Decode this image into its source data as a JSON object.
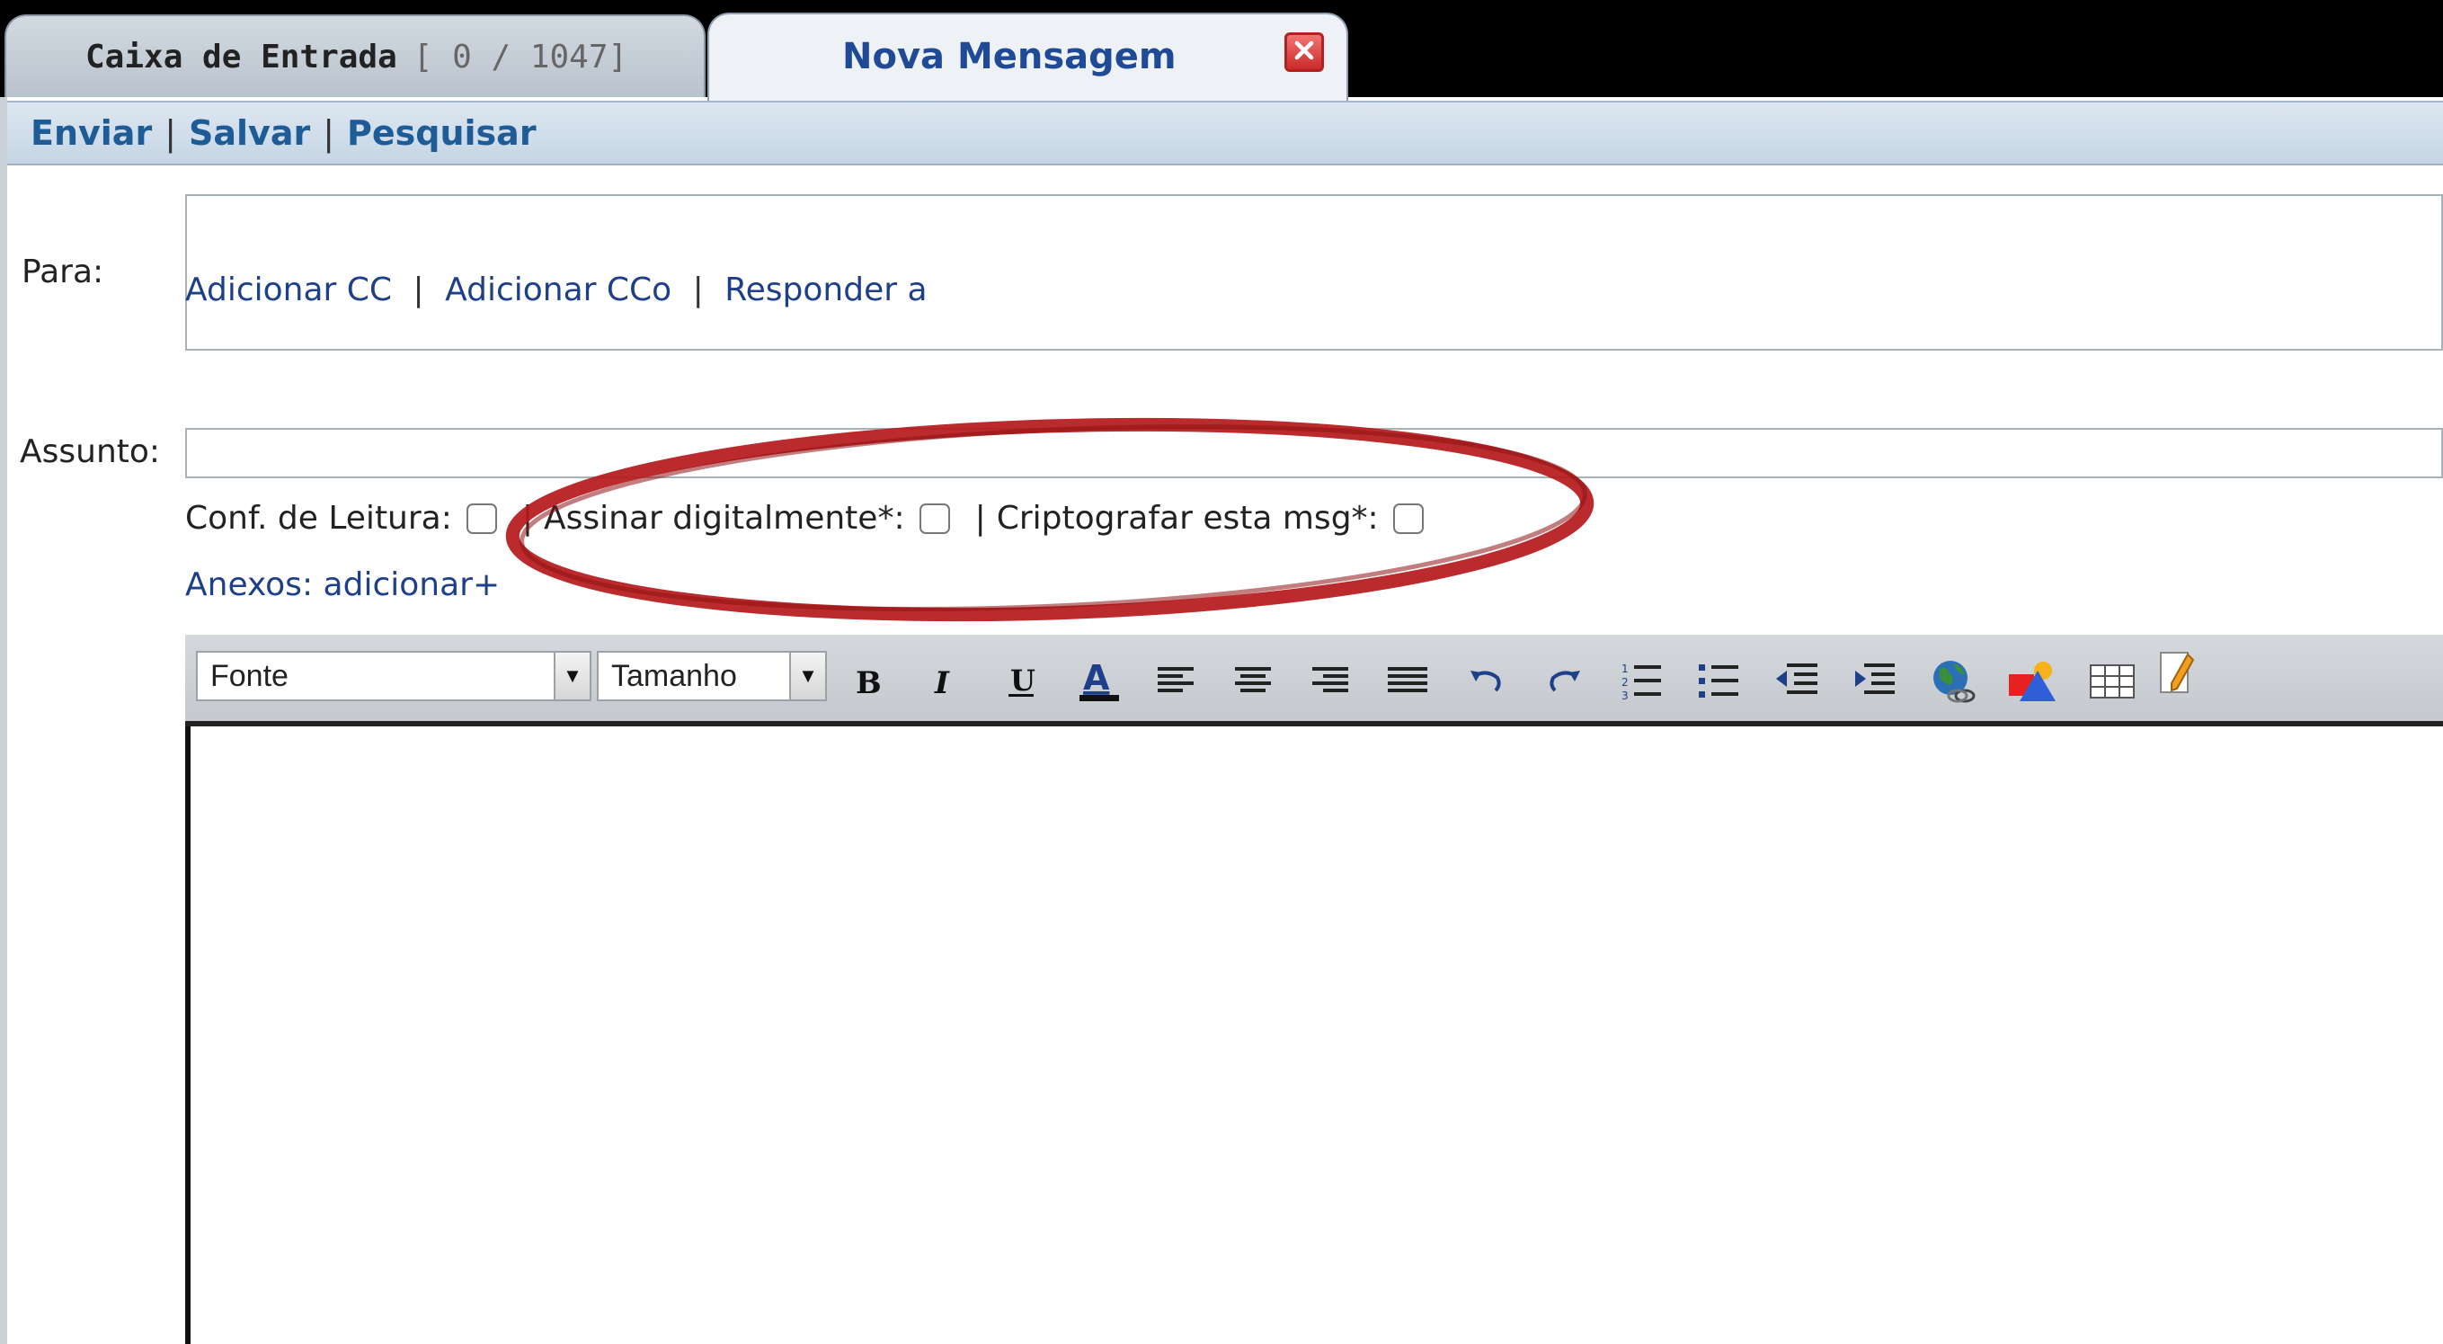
{
  "tabs": {
    "inbox": {
      "label": "Caixa de Entrada",
      "count": "[ 0 / 1047]"
    },
    "new_message": {
      "label": "Nova Mensagem"
    }
  },
  "toolbar": {
    "send": "Enviar",
    "save": "Salvar",
    "search": "Pesquisar",
    "separator": "|"
  },
  "form": {
    "to_label": "Para:",
    "to_value": "",
    "links": {
      "add_cc": "Adicionar CC",
      "add_bcc": "Adicionar CCo",
      "reply_to": "Responder a",
      "separator": "|"
    },
    "subject_label": "Assunto:",
    "subject_value": "",
    "options": {
      "read_receipt": {
        "label": "Conf. de Leitura:",
        "checked": false
      },
      "digital_sign": {
        "label": "Assinar digitalmente*:",
        "checked": false
      },
      "encrypt": {
        "label": "Criptografar esta msg*:",
        "checked": false
      },
      "separator": "|"
    },
    "attachments": {
      "label": "Anexos:",
      "add": "adicionar+"
    }
  },
  "editor": {
    "font_select": {
      "value": "Fonte",
      "options": [
        "Fonte"
      ]
    },
    "size_select": {
      "value": "Tamanho",
      "options": [
        "Tamanho"
      ]
    },
    "buttons": [
      "bold-icon",
      "italic-icon",
      "underline-icon",
      "font-color-icon",
      "align-left-icon",
      "align-center-icon",
      "align-right-icon",
      "align-justify-icon",
      "undo-icon",
      "redo-icon",
      "ordered-list-icon",
      "unordered-list-icon",
      "outdent-icon",
      "indent-icon",
      "insert-link-icon",
      "insert-image-icon",
      "insert-table-icon",
      "edit-source-icon"
    ],
    "content": ""
  },
  "colors": {
    "tab_active_text": "#1e4a96",
    "link": "#1e3f8a",
    "toolbar_action": "#1e5c98",
    "annotation": "#b5191c",
    "close_button": "#cc2a2a"
  }
}
